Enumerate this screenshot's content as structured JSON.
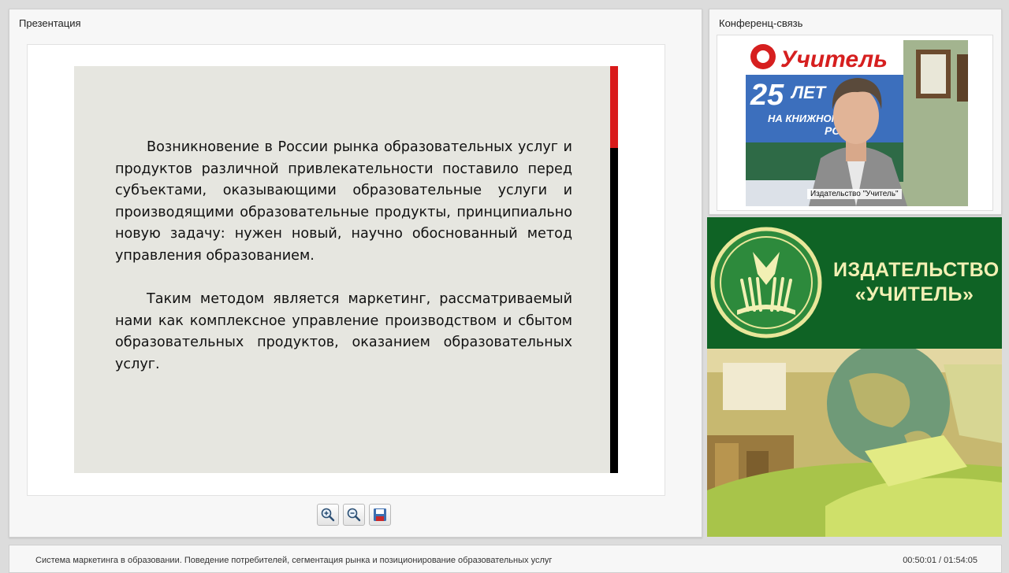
{
  "presentation": {
    "title": "Презентация",
    "slide": {
      "paragraphs": [
        "Возникновение в России рынка образовательных услуг и продуктов различной привлекательности поставило перед субъектами, оказывающими образовательные услуги и производящими образовательные продукты, принципиально новую задачу: нужен новый, научно обоснованный метод управления образованием.",
        "Таким методом является маркетинг, рассматриваемый нами как комплексное управление производством и сбытом образовательных продуктов, оказанием образовательных услуг."
      ],
      "colors": {
        "background": "#e6e6e0",
        "accent_red": "#d91a1a",
        "accent_black": "#000000"
      }
    },
    "toolbar": {
      "zoom_in_icon": "zoom-in-icon",
      "zoom_out_icon": "zoom-out-icon",
      "save_icon": "floppy-disk-icon"
    }
  },
  "conference": {
    "title": "Конференц-связь",
    "video_caption": "Издательство \"Учитель\"",
    "backdrop": {
      "brand": "Учитель",
      "years": "25",
      "years_word": "ЛЕТ",
      "line": "НА КНИЖНОМ Р",
      "country": "РОСС"
    }
  },
  "banner": {
    "line1": "ИЗДАТЕЛЬСТВО",
    "line2": "«УЧИТЕЛЬ»",
    "colors": {
      "green": "#0f6325",
      "text": "#f2f0b4"
    }
  },
  "footer": {
    "title": "Система маркетинга в образовании. Поведение потребителей, сегментация рынка и позиционирование образовательных услуг",
    "time": "00:50:01 / 01:54:05"
  }
}
